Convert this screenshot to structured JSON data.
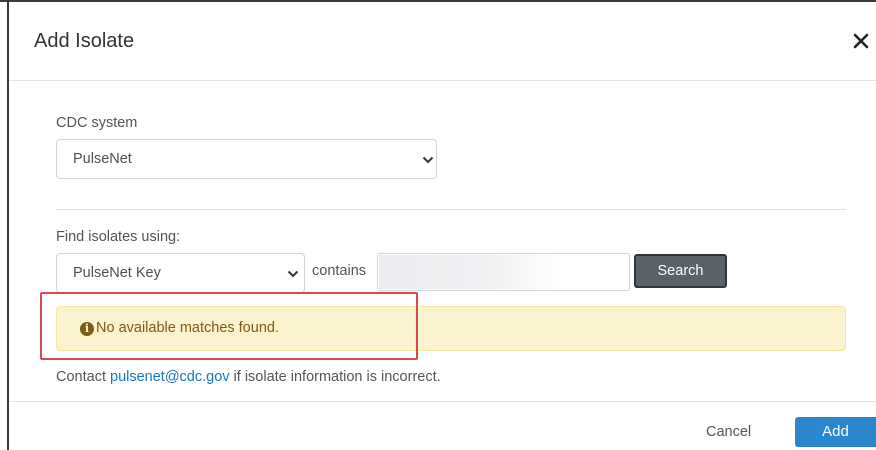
{
  "modal": {
    "title": "Add Isolate",
    "close_icon": "close-icon"
  },
  "cdc_system": {
    "label": "CDC system",
    "selected": "PulseNet",
    "icon": "chevron-down-icon"
  },
  "find": {
    "label": "Find isolates using:",
    "field_selected": "PulseNet Key",
    "operator_text": "contains",
    "search_value": "",
    "search_button": "Search"
  },
  "alert": {
    "icon": "info-circle-icon",
    "message": "No available matches found.",
    "colors": {
      "background": "#fbf2ce",
      "text": "#7c5c12",
      "highlight_border": "#e0474c"
    }
  },
  "contact": {
    "prefix": "Contact ",
    "email": "pulsenet@cdc.gov",
    "suffix": " if isolate information is incorrect."
  },
  "footer": {
    "cancel_label": "Cancel",
    "add_label": "Add"
  },
  "colors": {
    "link": "#1a76c2",
    "primary_button": "#2a86cf",
    "search_button": "#5a6268"
  }
}
